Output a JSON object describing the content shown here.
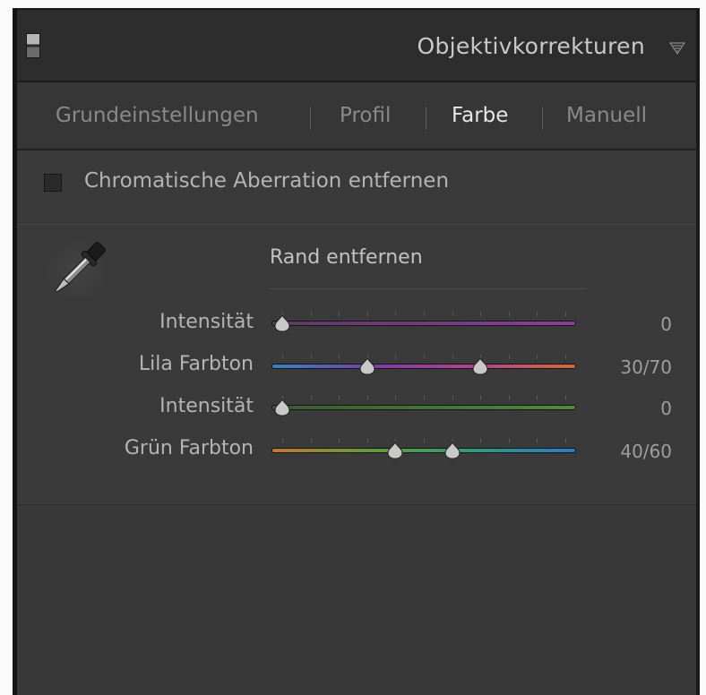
{
  "panel": {
    "title": "Objektivkorrekturen",
    "collapse_icon": "triangle-down-icon"
  },
  "tabs": [
    {
      "label": "Grundeinstellungen",
      "active": false
    },
    {
      "label": "Profil",
      "active": false
    },
    {
      "label": "Farbe",
      "active": true
    },
    {
      "label": "Manuell",
      "active": false
    }
  ],
  "chromatic": {
    "label": "Chromatische Aberration entfernen",
    "checked": false
  },
  "defringe": {
    "heading": "Rand entfernen",
    "tool_icon": "eyedropper-icon",
    "sliders": [
      {
        "label": "Intensität",
        "value_text": "0",
        "thumbs": [
          0
        ],
        "range": [
          0,
          100
        ],
        "gradient": [
          "#5a3a62",
          "#8b3f9c"
        ]
      },
      {
        "label": "Lila Farbton",
        "value_text": "30/70",
        "thumbs": [
          30,
          70
        ],
        "range": [
          0,
          100
        ],
        "gradient": [
          "#2f86c4",
          "#7a3fa8",
          "#b4418f",
          "#d36a3a"
        ]
      },
      {
        "label": "Intensität",
        "value_text": "0",
        "thumbs": [
          0
        ],
        "range": [
          0,
          100
        ],
        "gradient": [
          "#3a5a32",
          "#4f8a3c"
        ]
      },
      {
        "label": "Grün Farbton",
        "value_text": "40/60",
        "thumbs": [
          40,
          60
        ],
        "range": [
          0,
          100
        ],
        "gradient": [
          "#c07a2a",
          "#5f9a3a",
          "#2e9a7a",
          "#2a7ac8"
        ]
      }
    ]
  },
  "colors": {
    "panel_bg": "#3a3a3a",
    "header_bg": "#2d2d2d",
    "active_tab": "#e6e6e6",
    "inactive_tab": "#8a8a8a"
  }
}
